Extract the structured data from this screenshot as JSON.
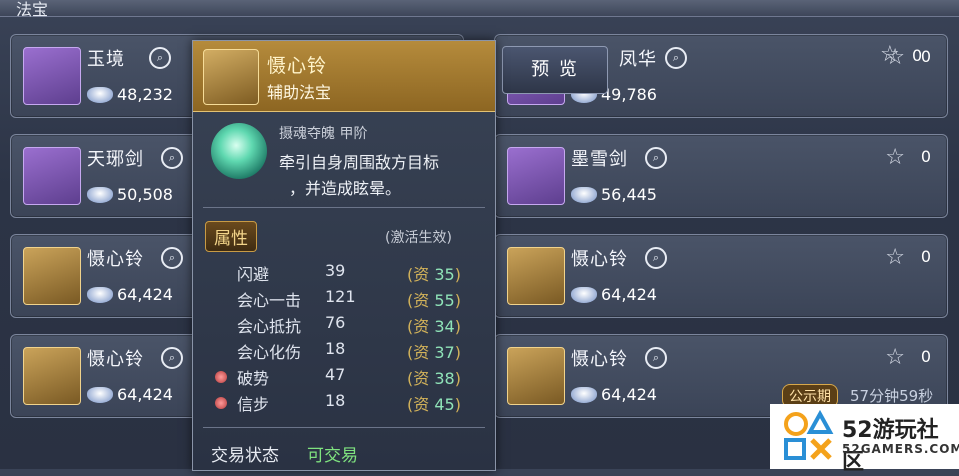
{
  "header": {
    "title": "法宝"
  },
  "cards": [
    {
      "name": "玉境",
      "price": "48,232",
      "stars": "0",
      "icon": "jade-mirror-icon"
    },
    {
      "name": "凤华",
      "price": "49,786",
      "stars": "0",
      "icon": "phoenix-icon"
    },
    {
      "name": "天琊剑",
      "price": "50,508",
      "stars": "0",
      "icon": "sword-icon"
    },
    {
      "name": "墨雪剑",
      "price": "56,445",
      "stars": "0",
      "icon": "sword-icon"
    },
    {
      "name": "慑心铃",
      "price": "64,424",
      "stars": "0",
      "icon": "bell-icon"
    },
    {
      "name": "慑心铃",
      "price": "64,424",
      "stars": "0",
      "icon": "bell-icon"
    },
    {
      "name": "慑心铃",
      "price": "64,424",
      "stars": "0",
      "icon": "bell-icon"
    },
    {
      "name": "慑心铃",
      "price": "64,424",
      "stars": "0",
      "icon": "bell-icon"
    }
  ],
  "preview_button": "预 览",
  "tooltip": {
    "name": "慑心铃",
    "type": "辅助法宝",
    "skill_title": "摄魂夺魄 甲阶",
    "skill_desc_1": "牵引自身周围敌方目标",
    "skill_desc_2": "，并造成眩晕。",
    "attr_tag": "属性",
    "attr_note": "(激活生效)",
    "attributes": [
      {
        "label": "闪避",
        "value": "39",
        "quality": "35",
        "marked": false
      },
      {
        "label": "会心一击",
        "value": "121",
        "quality": "55",
        "marked": false
      },
      {
        "label": "会心抵抗",
        "value": "76",
        "quality": "34",
        "marked": false
      },
      {
        "label": "会心化伤",
        "value": "18",
        "quality": "37",
        "marked": false
      },
      {
        "label": "破势",
        "value": "47",
        "quality": "38",
        "marked": true
      },
      {
        "label": "信步",
        "value": "18",
        "quality": "45",
        "marked": true
      }
    ],
    "quality_label": "资",
    "trade_label": "交易状态",
    "trade_value": "可交易"
  },
  "public": {
    "tag": "公示期",
    "time": "57分钟59秒"
  },
  "watermark": {
    "brand": "52游玩社区",
    "domain": "52GAMERS.COM"
  },
  "colors": {
    "gold": "#b58b3c",
    "tradeable_green": "#7fe27f",
    "quality_green": "#8fe3b8"
  }
}
